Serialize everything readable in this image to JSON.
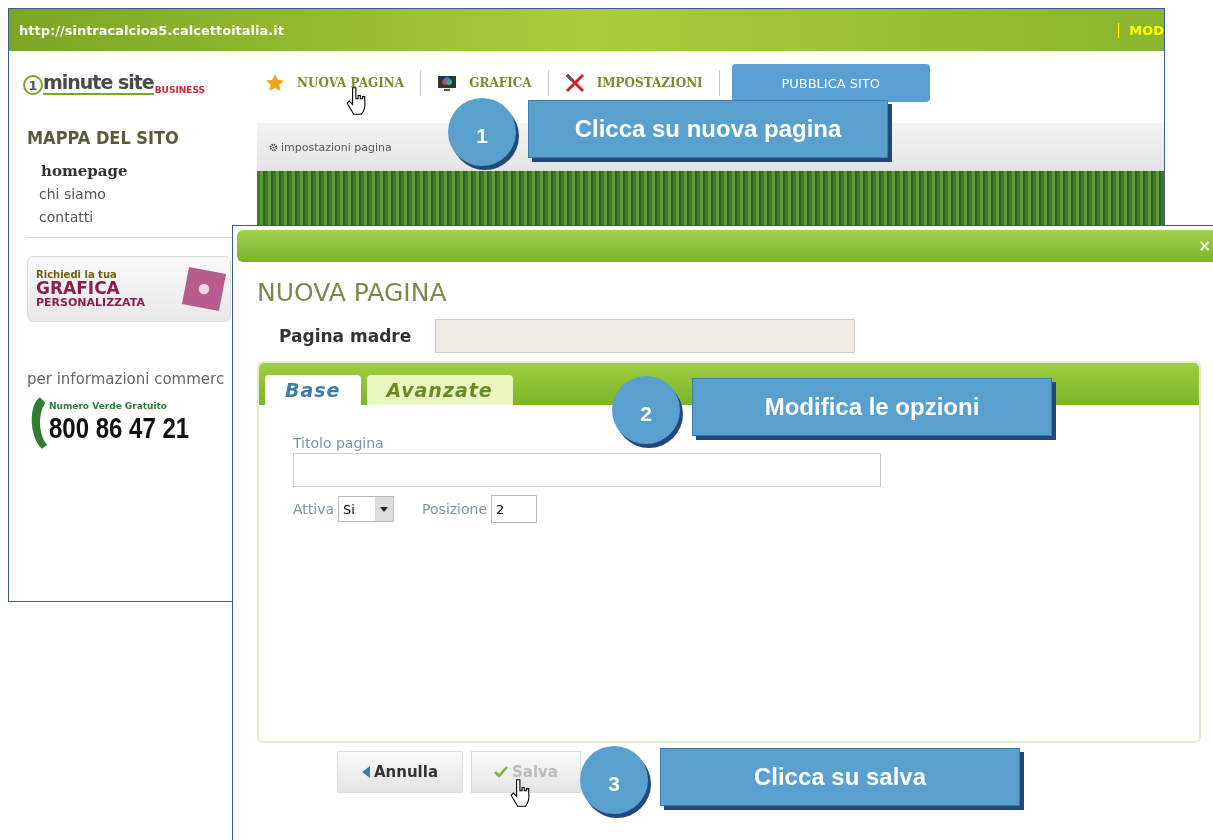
{
  "browser": {
    "url": "http://sintracalcioa5.calcettoitalia.it",
    "right_link": "MOD"
  },
  "logo": {
    "digit": "1",
    "text": "minute site",
    "badge": "BUSINESS"
  },
  "nav": [
    {
      "label": "NUOVA PAGINA"
    },
    {
      "label": "GRAFICA"
    },
    {
      "label": "IMPOSTAZIONI"
    }
  ],
  "publish_button": "PUBBLICA SITO",
  "sidebar": {
    "title": "MAPPA DEL SITO",
    "items": [
      {
        "label": "homepage",
        "selected": true
      },
      {
        "label": "chi siamo",
        "selected": false
      },
      {
        "label": "contatti",
        "selected": false
      }
    ],
    "banner": {
      "line1": "Richiedi la tua",
      "line2": "GRAFICA",
      "line3": "PERSONALIZZATA"
    },
    "info": "per informazioni commerc",
    "phone_label": "Numero Verde Gratuito",
    "phone": "800 86 47 21"
  },
  "toolbar": {
    "item": "impostazioni pagina"
  },
  "dialog": {
    "title": "NUOVA PAGINA",
    "close": "×",
    "parent_label": "Pagina madre",
    "tabs": [
      {
        "label": "Base",
        "selected": true
      },
      {
        "label": "Avanzate",
        "selected": false
      }
    ],
    "title_label": "Titolo pagina",
    "active_label": "Attiva",
    "active_value": "Si",
    "position_label": "Posizione",
    "position_value": "2",
    "buttons": [
      {
        "label": "Annulla",
        "kind": "cancel",
        "disabled": false
      },
      {
        "label": "Salva",
        "kind": "save",
        "disabled": true
      }
    ]
  },
  "callouts": [
    {
      "number": "1",
      "text": "Clicca su nuova pagina"
    },
    {
      "number": "2",
      "text": "Modifica le opzioni"
    },
    {
      "number": "3",
      "text": "Clicca su salva"
    }
  ]
}
